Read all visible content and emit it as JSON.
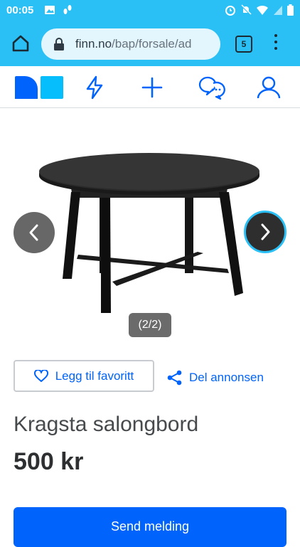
{
  "status_bar": {
    "time": "00:05",
    "icons": [
      "image-icon",
      "footprints-icon",
      "alarm-icon",
      "bell-off-icon",
      "wifi-icon",
      "signal-icon",
      "battery-icon"
    ]
  },
  "browser": {
    "url_domain": "finn.no",
    "url_path": "/bap/forsale/ad",
    "tab_count": "5"
  },
  "app_nav": {
    "items": [
      "finn-logo",
      "lightning-icon",
      "plus-icon",
      "chat-icon",
      "user-icon"
    ]
  },
  "gallery": {
    "counter": "(2/2)"
  },
  "actions": {
    "favorite_label": "Legg til favoritt",
    "share_label": "Del annonsen"
  },
  "ad": {
    "title": "Kragsta salongbord",
    "price": "500 kr"
  },
  "cta": {
    "send_label": "Send melding"
  },
  "colors": {
    "accent_blue": "#0063fb",
    "bar_cyan": "#2bc0f5",
    "finn_logo_dark": "#0063fb",
    "finn_logo_light": "#06befb"
  }
}
